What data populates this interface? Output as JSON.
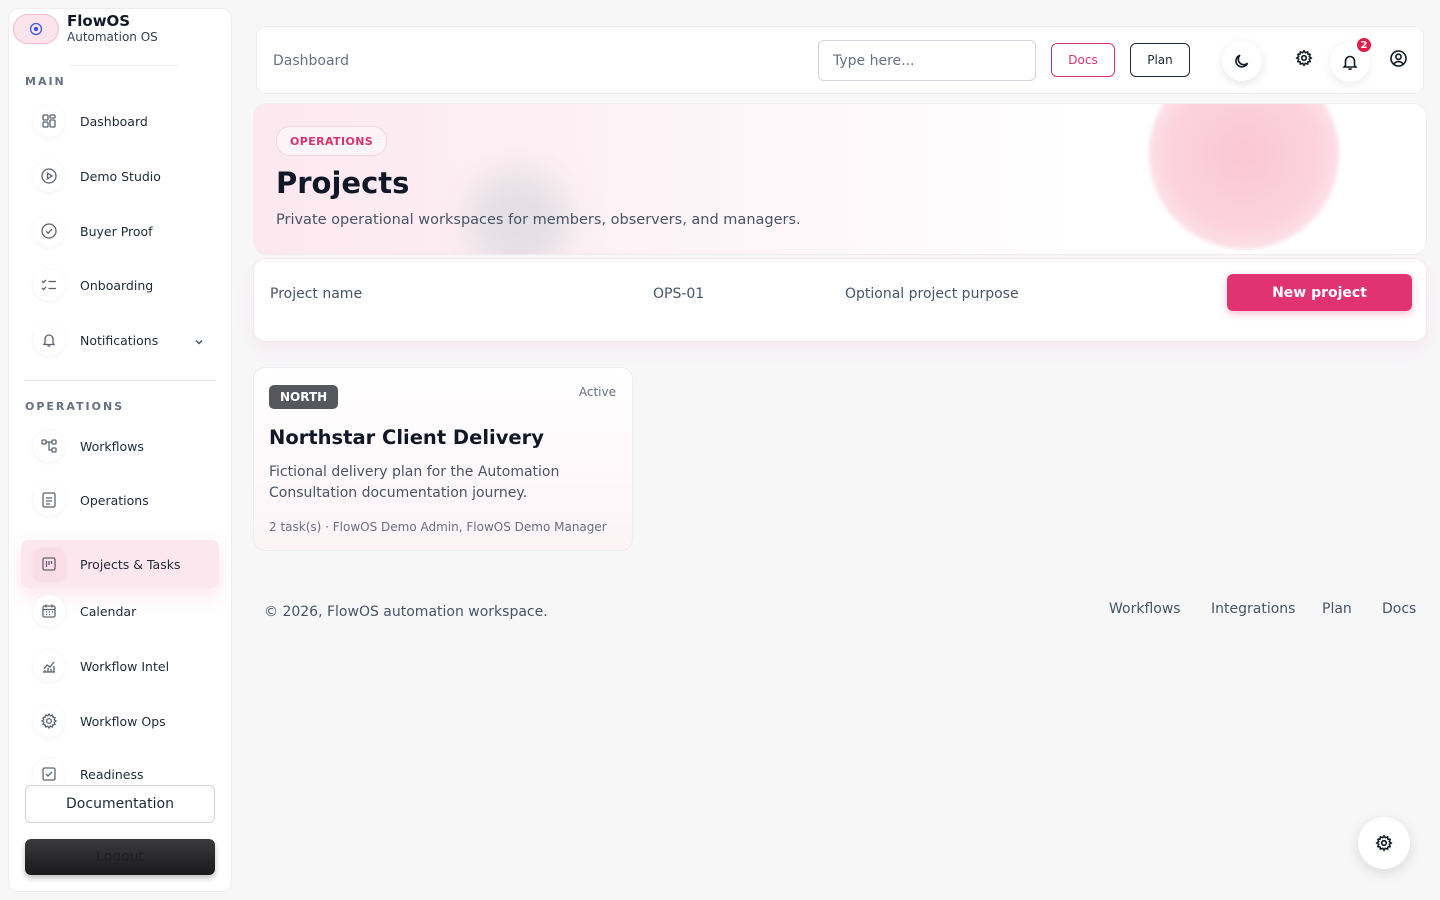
{
  "brand": {
    "name": "FlowOS",
    "subtitle": "Automation OS",
    "logo_icon": "target-icon"
  },
  "sidebar": {
    "main_label": "MAIN",
    "main_items": [
      {
        "label": "Dashboard",
        "icon": "grid-icon"
      },
      {
        "label": "Demo Studio",
        "icon": "play-circle-icon"
      },
      {
        "label": "Buyer Proof",
        "icon": "badge-check-icon"
      },
      {
        "label": "Onboarding",
        "icon": "checklist-icon"
      },
      {
        "label": "Notifications",
        "icon": "bell-icon"
      }
    ],
    "operations_label": "OPERATIONS",
    "ops_items": [
      {
        "label": "Workflows",
        "icon": "workflow-icon"
      },
      {
        "label": "Operations",
        "icon": "clipboard-icon"
      },
      {
        "label": "Projects & Tasks",
        "icon": "kanban-icon",
        "active": true
      },
      {
        "label": "Calendar",
        "icon": "calendar-icon"
      },
      {
        "label": "Workflow Intel",
        "icon": "chart-icon"
      },
      {
        "label": "Workflow Ops",
        "icon": "gear-icon"
      },
      {
        "label": "Readiness",
        "icon": "checkbox-icon"
      }
    ],
    "documentation_label": "Documentation",
    "logout_label": "Logout"
  },
  "topbar": {
    "breadcrumb": "Dashboard",
    "search_placeholder": "Type here...",
    "docs_label": "Docs",
    "plan_label": "Plan",
    "notification_count": "2"
  },
  "hero": {
    "pill": "OPERATIONS",
    "title": "Projects",
    "subtitle": "Private operational workspaces for members, observers, and managers."
  },
  "form": {
    "name_placeholder": "Project name",
    "code_value": "OPS-01",
    "purpose_placeholder": "Optional project purpose",
    "submit_label": "New project"
  },
  "project_card": {
    "tag": "NORTH",
    "status": "Active",
    "title": "Northstar Client Delivery",
    "description": "Fictional delivery plan for the Automation Consultation documentation journey.",
    "meta": "2 task(s) · FlowOS Demo Admin, FlowOS Demo Manager"
  },
  "footer": {
    "copyright": "© 2026, FlowOS automation workspace.",
    "links": [
      "Workflows",
      "Integrations",
      "Plan",
      "Docs"
    ]
  },
  "colors": {
    "accent": "#e0336f",
    "accent_soft": "#fce7ee",
    "text": "#101828"
  }
}
